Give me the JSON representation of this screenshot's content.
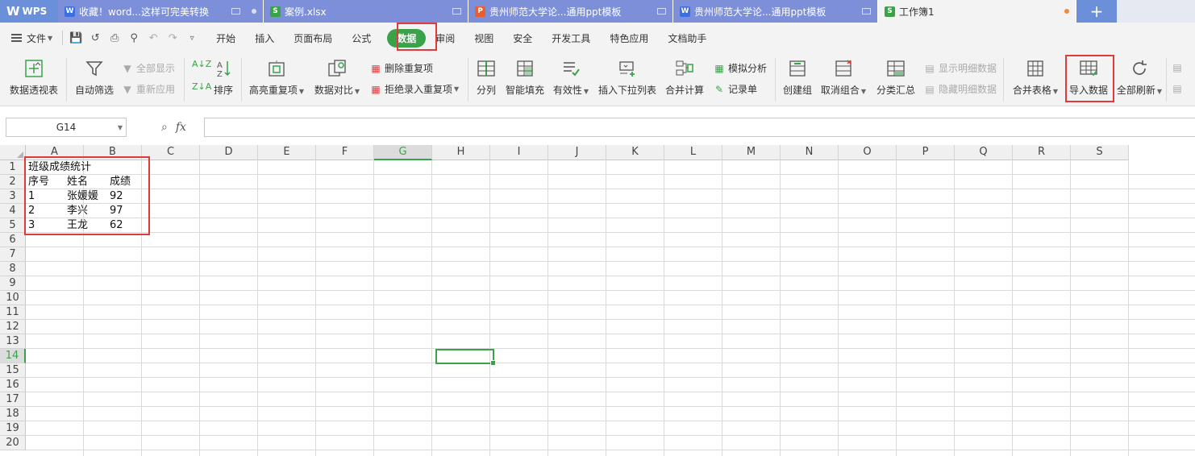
{
  "tabs": {
    "logo": "WPS",
    "items": [
      {
        "type": "W",
        "title": "收藏！word...这样可完美转换",
        "active": false
      },
      {
        "type": "S",
        "title": "案例.xlsx",
        "active": false
      },
      {
        "type": "P",
        "title": "贵州师范大学论...通用ppt模板",
        "active": false
      },
      {
        "type": "W",
        "title": "贵州师范大学论...通用ppt模板",
        "active": false
      },
      {
        "type": "S",
        "title": "工作簿1",
        "active": true
      }
    ],
    "new_tab": "+"
  },
  "menu": {
    "file": "文件",
    "tabs": [
      "开始",
      "插入",
      "页面布局",
      "公式",
      "数据",
      "审阅",
      "视图",
      "安全",
      "开发工具",
      "特色应用",
      "文档助手"
    ],
    "active_tab": "数据"
  },
  "ribbon": {
    "pivot": "数据透视表",
    "autofilter": "自动筛选",
    "show_all": "全部显示",
    "reapply": "重新应用",
    "sort": "排序",
    "highlight_dup": "高亮重复项",
    "compare": "数据对比",
    "remove_dup": "删除重复项",
    "reject_dup": "拒绝录入重复项",
    "split": "分列",
    "smart_fill": "智能填充",
    "validity": "有效性",
    "insert_dropdown": "插入下拉列表",
    "consolidate": "合并计算",
    "whatif": "模拟分析",
    "record": "记录单",
    "create_group": "创建组",
    "ungroup": "取消组合",
    "subtotal": "分类汇总",
    "show_detail": "显示明细数据",
    "hide_detail": "隐藏明细数据",
    "merge_tables": "合并表格",
    "import_data": "导入数据",
    "refresh_all": "全部刷新"
  },
  "formula_bar": {
    "cell_ref": "G14",
    "fx": "fx",
    "formula": ""
  },
  "sheet": {
    "columns": [
      "A",
      "B",
      "C",
      "D",
      "E",
      "F",
      "G",
      "H",
      "I",
      "J",
      "K",
      "L",
      "M",
      "N",
      "O",
      "P",
      "Q",
      "R",
      "S"
    ],
    "selected_column": "G",
    "rows": [
      "1",
      "2",
      "3",
      "4",
      "5",
      "6",
      "7",
      "8",
      "9",
      "10",
      "11",
      "12",
      "13",
      "14",
      "15",
      "16",
      "17",
      "18",
      "19",
      "20"
    ],
    "selected_row": "14",
    "content": {
      "r1_a": "班级成绩统计",
      "r2_a": "序号",
      "r2_b": "姓名",
      "r2_c": "成绩",
      "r3_a": "1",
      "r3_b": "张媛媛",
      "r3_c": "92",
      "r4_a": "2",
      "r4_b": "李兴",
      "r4_c": "97",
      "r5_a": "3",
      "r5_b": "王龙",
      "r5_c": "62"
    }
  },
  "colors": {
    "accent": "#3aa34a",
    "highlight_box": "#e03b3b"
  }
}
